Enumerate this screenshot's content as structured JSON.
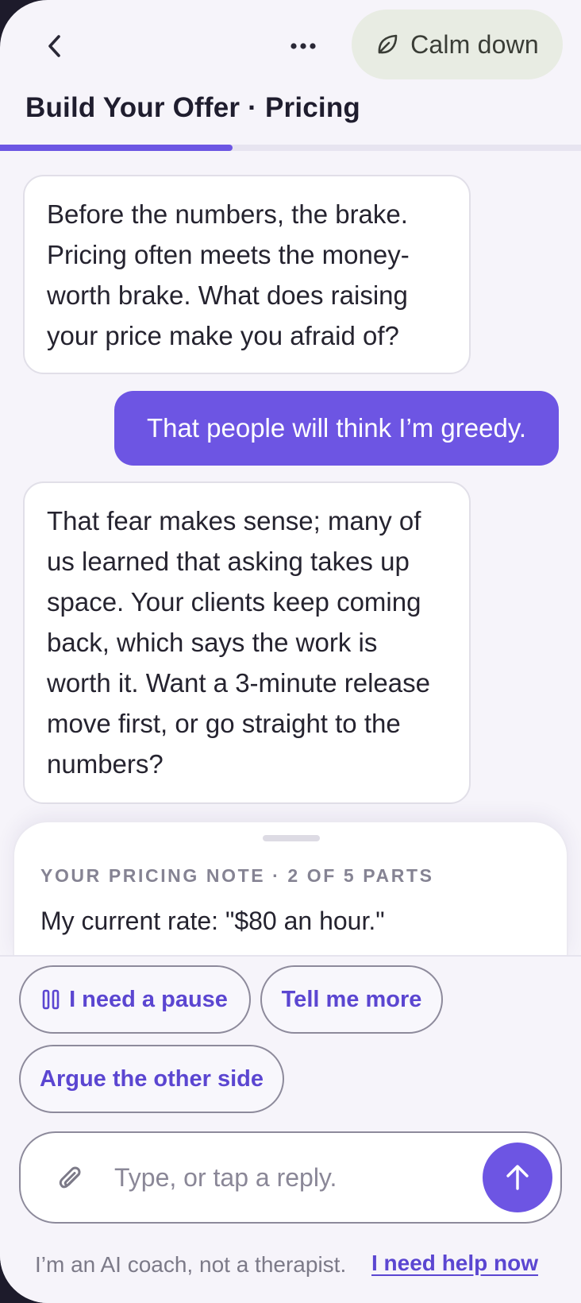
{
  "header": {
    "calm_label": "Calm down",
    "title": "Build Your Offer · Pricing",
    "progress": 0.4
  },
  "chat": {
    "messages": [
      {
        "role": "coach",
        "text": "Before the numbers, the brake. Pricing often meets the money-worth brake. What does raising your price make you afraid of?"
      },
      {
        "role": "user",
        "text": "That people will think I’m greedy."
      },
      {
        "role": "coach",
        "text": "That fear makes sense; many of us learned that asking takes up space. Your clients keep coming back, which says the work is worth it. Want a 3-minute release move first, or go straight to the numbers?"
      }
    ]
  },
  "note": {
    "caption": "YOUR PRICING NOTE · 2 OF 5 PARTS",
    "text": "My current rate: \"$80 an hour.\""
  },
  "quick_replies": {
    "pause": "I need a pause",
    "more": "Tell me more",
    "argue": "Argue the other side"
  },
  "composer": {
    "placeholder": "Type, or tap a reply."
  },
  "footer": {
    "disclaimer": "I’m an AI coach, not a therapist.",
    "help_link": "I need help now"
  },
  "colors": {
    "accent": "#6d55e3",
    "background": "#f6f4fa",
    "calm_chip": "#e8ece3"
  },
  "icons": [
    "back-chevron-icon",
    "more-dots-icon",
    "leaf-icon",
    "pause-icon",
    "paperclip-icon",
    "send-arrow-icon"
  ]
}
